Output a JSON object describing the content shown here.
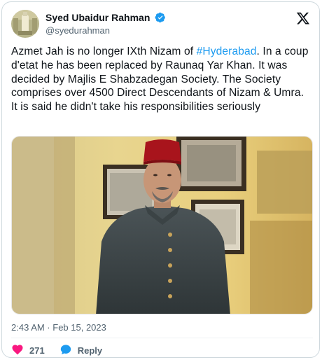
{
  "author": {
    "name": "Syed Ubaidur Rahman",
    "handle": "@syedurahman",
    "verified_icon": "verified-badge-icon"
  },
  "tweet": {
    "text_before": "Azmet Jah is no longer IXth Nizam of ",
    "hashtag": "#Hyderabad",
    "text_after": ". In a coup d'etat he has been replaced by Raunaq Yar Khan. It was decided by Majlis E Shabzadegan Society. The Society comprises over 4500 Direct Descendants of Nizam & Umra. It is said he didn't take his responsibilities seriously",
    "timestamp": "2:43 AM · Feb 15, 2023"
  },
  "actions": {
    "like_count": "271",
    "reply_label": "Reply"
  },
  "colors": {
    "accent": "#1d9bf0",
    "like": "#f91880",
    "muted": "#536471"
  }
}
